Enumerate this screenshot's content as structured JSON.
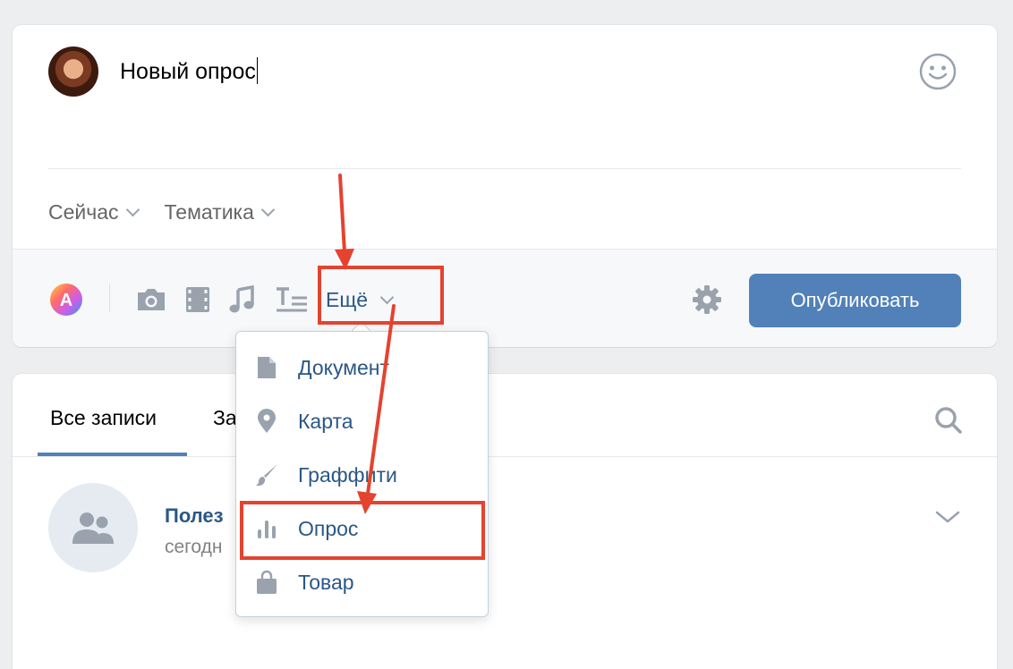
{
  "composer": {
    "text": "Новый опрос",
    "meta": {
      "time_label": "Сейчас",
      "topic_label": "Тематика"
    },
    "toolbar": {
      "more_label": "Ещё",
      "publish_label": "Опубликовать"
    }
  },
  "feed": {
    "tabs": [
      {
        "label": "Все записи"
      },
      {
        "label": "За"
      }
    ],
    "post": {
      "author": "Полез",
      "date": "сегодн"
    }
  },
  "dropdown": {
    "items": [
      {
        "label": "Документ",
        "icon": "document-icon"
      },
      {
        "label": "Карта",
        "icon": "map-pin-icon"
      },
      {
        "label": "Граффити",
        "icon": "brush-icon"
      },
      {
        "label": "Опрос",
        "icon": "poll-icon"
      },
      {
        "label": "Товар",
        "icon": "shopping-bag-icon"
      }
    ]
  },
  "colors": {
    "accent": "#5181b8",
    "link": "#2a5885",
    "annotation": "#e4432f",
    "icon": "#99a2ad"
  }
}
